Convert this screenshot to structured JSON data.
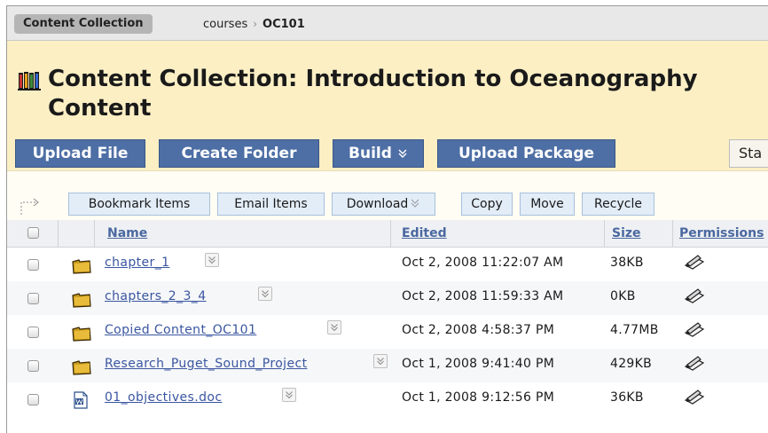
{
  "breadcrumb": {
    "home": "Content Collection",
    "path": [
      "courses",
      "OC101"
    ],
    "separator": "›"
  },
  "header": {
    "title": "Content Collection: Introduction to Oceanography Content",
    "buttons": {
      "upload_file": "Upload File",
      "create_folder": "Create Folder",
      "build": "Build",
      "upload_package": "Upload Package",
      "status_partial": "Sta"
    }
  },
  "actions": {
    "bookmark": "Bookmark Items",
    "email": "Email Items",
    "download": "Download",
    "copy": "Copy",
    "move": "Move",
    "recycle": "Recycle"
  },
  "table": {
    "columns": {
      "name": "Name",
      "edited": "Edited",
      "size": "Size",
      "permissions": "Permissions"
    },
    "rows": [
      {
        "name": "chapter_1",
        "type": "folder",
        "edited": "Oct 2, 2008 11:22:07 AM",
        "size": "38KB"
      },
      {
        "name": "chapters_2_3_4",
        "type": "folder",
        "edited": "Oct 2, 2008 11:59:33 AM",
        "size": "0KB"
      },
      {
        "name": "Copied Content_OC101",
        "type": "folder",
        "edited": "Oct 2, 2008 4:58:37 PM",
        "size": "4.77MB"
      },
      {
        "name": "Research_Puget_Sound_Project",
        "type": "folder",
        "edited": "Oct 1, 2008 9:41:40 PM",
        "size": "429KB"
      },
      {
        "name": "01_objectives.doc",
        "type": "document",
        "edited": "Oct 1, 2008 9:12:56 PM",
        "size": "36KB"
      }
    ]
  },
  "icons": {
    "title": "books-icon",
    "folder": "folder-icon",
    "document": "word-document-icon",
    "permissions": "permissions-pencil-icon",
    "menu": "chevron-down-icon"
  },
  "colors": {
    "header_bg": "#fcefc4",
    "button_blue": "#4e6fa5",
    "link": "#3a56a0",
    "column_header": "#4a68a0"
  }
}
